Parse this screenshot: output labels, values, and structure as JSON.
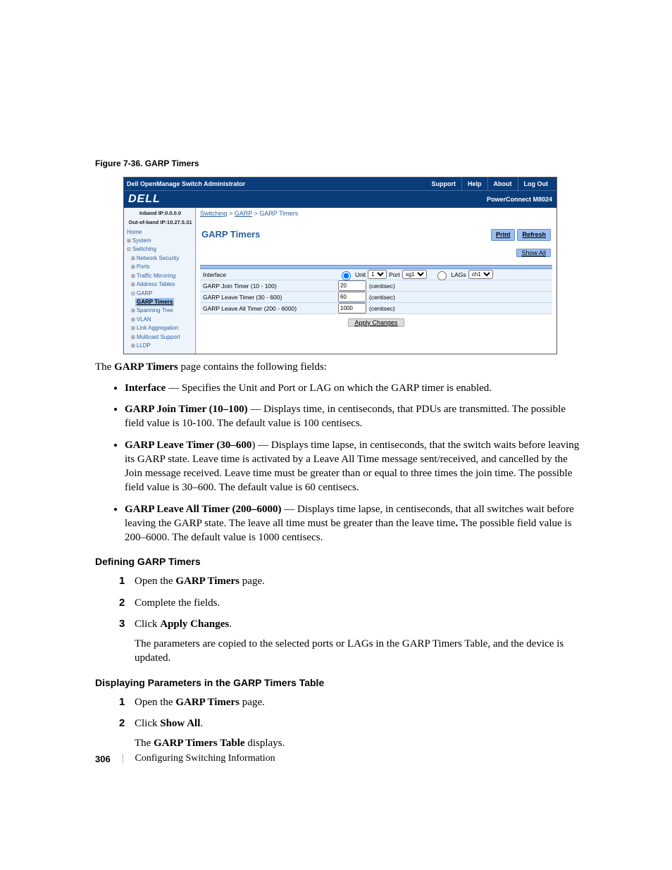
{
  "figure_caption": "Figure 7-36.    GARP Timers",
  "screenshot": {
    "topbar": {
      "title": "Dell OpenManage Switch Administrator",
      "nav": [
        "Support",
        "Help",
        "About",
        "Log Out"
      ]
    },
    "brand": "DELL",
    "product": "PowerConnect M8024",
    "sidebar": {
      "ip1": "Inband IP:0.0.0.0",
      "ip2": "Out-of-band IP:10.27.5.31",
      "items": {
        "home": "Home",
        "system": "System",
        "switching": "Switching",
        "netsec": "Network Security",
        "ports": "Ports",
        "traffic": "Traffic Mirroring",
        "addr": "Address Tables",
        "garp": "GARP",
        "garp_timers": "GARP Timers",
        "span": "Spanning Tree",
        "vlan": "VLAN",
        "lag": "Link Aggregation",
        "mcast": "Multicast Support",
        "lldp": "LLDP"
      }
    },
    "main": {
      "crumb_switching": "Switching",
      "crumb_garp": "GARP",
      "crumb_sep": " > ",
      "crumb_last": "GARP Timers",
      "title": "GARP Timers",
      "btn_print": "Print",
      "btn_refresh": "Refresh",
      "btn_showall": "Show All",
      "rows": {
        "interface": {
          "label": "Interface",
          "unit_lbl": "Unit",
          "unit_val": "1",
          "port_lbl": "Port",
          "port_val": "xg1",
          "lags_lbl": "LAGs",
          "lags_val": "ch1"
        },
        "join": {
          "label": "GARP Join Timer (10 - 100)",
          "val": "20",
          "unit": "(centisec)"
        },
        "leave": {
          "label": "GARP Leave Timer (30 - 600)",
          "val": "60",
          "unit": "(centisec)"
        },
        "leaveall": {
          "label": "GARP Leave All Timer (200 - 6000)",
          "val": "1000",
          "unit": "(centisec)"
        }
      },
      "apply": "Apply Changes"
    }
  },
  "doc": {
    "intro_pre": "The ",
    "intro_bold": "GARP Timers",
    "intro_post": " page contains the following fields:",
    "b1_b": "Interface",
    "b1_t": " — Specifies the Unit and Port or LAG on which the GARP timer is enabled.",
    "b2_b": "GARP Join Timer (10–100)",
    "b2_t": " — Displays time, in centiseconds, that PDUs are transmitted. The possible field value is 10-100. The default value is 100 centisecs.",
    "b3_b": "GARP Leave Timer (30–600",
    "b3_t": ") — Displays time lapse, in centiseconds, that the switch waits before leaving its GARP state. Leave time is activated by a Leave All Time message sent/received, and cancelled by the Join message received. Leave time must be greater than or equal to three times the join time. The possible field value is 30–600. The default value is 60 centisecs.",
    "b4_b": "GARP Leave All Timer (200–6000)",
    "b4_t1": " — Displays time lapse, in centiseconds, that all switches wait before leaving the GARP state. The leave all time must be greater than the leave time",
    "b4_t2": ". ",
    "b4_t3": "The possible field value is 200–6000. The default value is 1000 centisecs.",
    "h1": "Defining GARP Timers",
    "s1_pre": "Open the ",
    "s1_b": "GARP Timers",
    "s1_post": " page.",
    "s2": "Complete the fields.",
    "s3_pre": "Click ",
    "s3_b": "Apply Changes",
    "s3_post": ".",
    "s3_body": "The parameters are copied to the selected ports or LAGs in the GARP Timers Table, and the device is updated.",
    "h2": "Displaying Parameters in the GARP Timers Table",
    "d1_pre": "Open the ",
    "d1_b": "GARP Timers",
    "d1_post": " page.",
    "d2_pre": "Click ",
    "d2_b": "Show All",
    "d2_post": ".",
    "d2_body_pre": "The ",
    "d2_body_b": "GARP Timers Table",
    "d2_body_post": " displays."
  },
  "footer": {
    "page": "306",
    "section": "Configuring Switching Information"
  }
}
